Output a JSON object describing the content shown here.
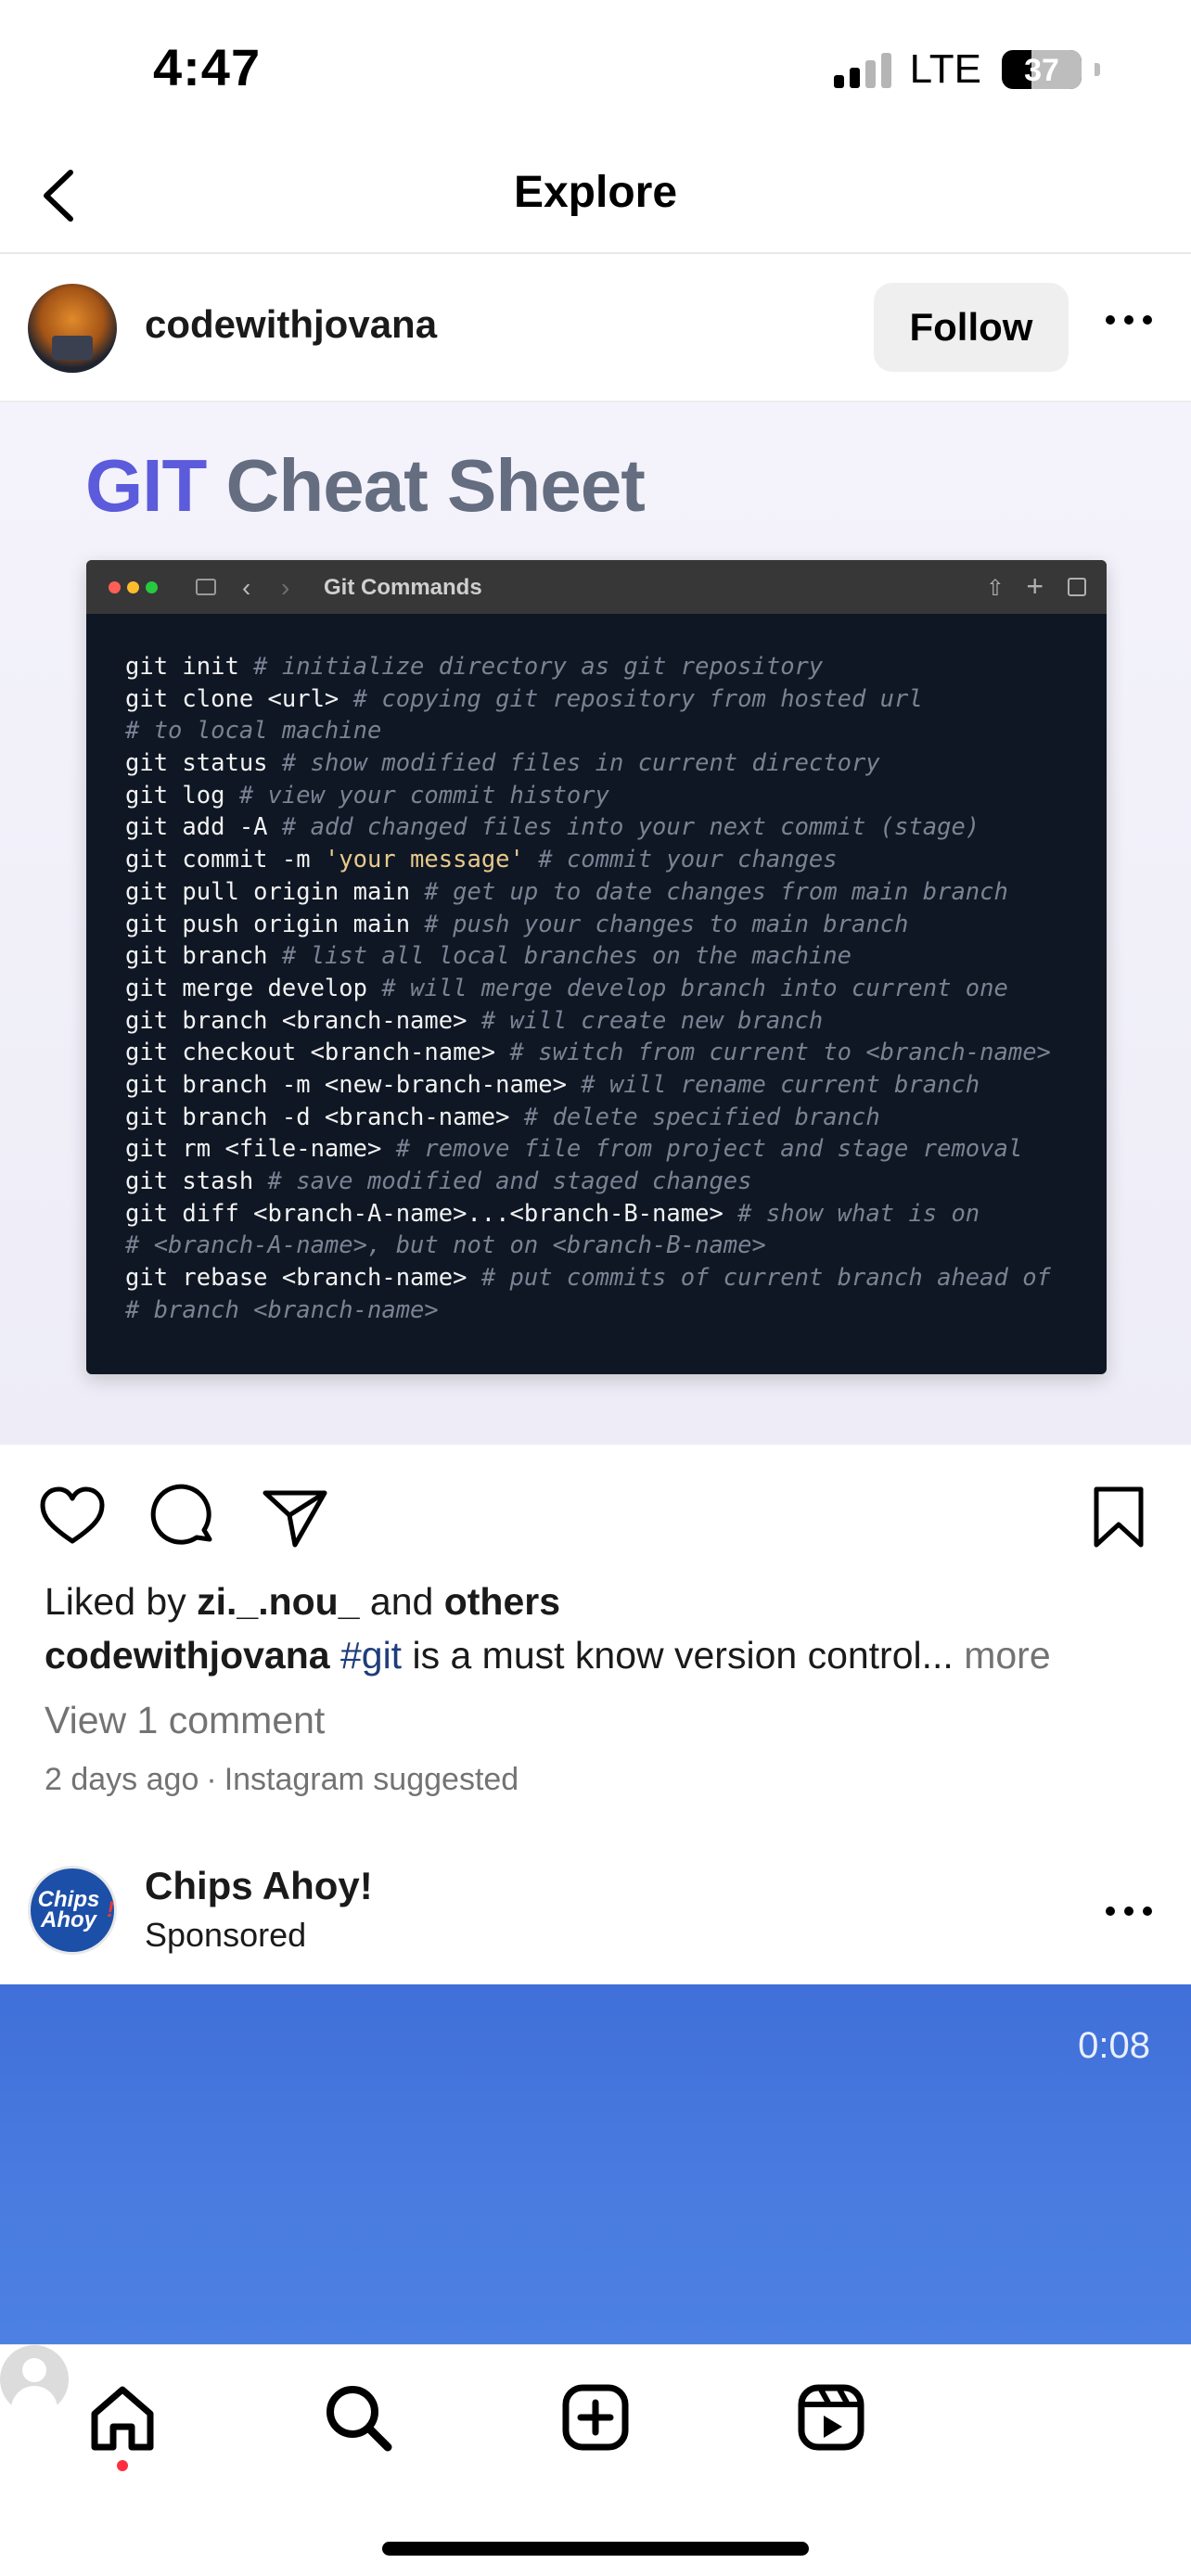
{
  "status_bar": {
    "time": "4:47",
    "network": "LTE",
    "battery": "37"
  },
  "nav": {
    "title": "Explore"
  },
  "post": {
    "username": "codewithjovana",
    "follow_label": "Follow",
    "image": {
      "title_accent": "GIT",
      "title_rest": " Cheat Sheet",
      "window_title": "Git Commands",
      "code_lines": [
        {
          "cmd": "git init ",
          "cmt": "# initialize directory as git repository"
        },
        {
          "cmd": "git clone <url> ",
          "cmt": "# copying git repository from hosted url"
        },
        {
          "cmd": "",
          "cmt": "# to local machine"
        },
        {
          "cmd": "git status ",
          "cmt": "# show modified files in current directory"
        },
        {
          "cmd": "git log ",
          "cmt": "# view your commit history"
        },
        {
          "cmd": "git add -A ",
          "cmt": "# add changed files into your next commit (stage)"
        },
        {
          "cmd": "git commit -m ",
          "str": "'your message'",
          "cmd2": " ",
          "cmt": "# commit your changes"
        },
        {
          "cmd": "git pull origin main ",
          "cmt": "# get up to date changes from main branch"
        },
        {
          "cmd": "git push origin main ",
          "cmt": "# push your changes to main branch"
        },
        {
          "cmd": "git branch ",
          "cmt": "# list all local branches on the machine"
        },
        {
          "cmd": "git merge develop ",
          "cmt": "# will merge develop branch into current one"
        },
        {
          "cmd": "git branch <branch-name> ",
          "cmt": "# will create new branch"
        },
        {
          "cmd": "git checkout <branch-name> ",
          "cmt": "# switch from current to <branch-name>"
        },
        {
          "cmd": "git branch -m <new-branch-name> ",
          "cmt": "# will rename current branch"
        },
        {
          "cmd": "git branch -d <branch-name> ",
          "cmt": "# delete specified branch"
        },
        {
          "cmd": "git rm <file-name> ",
          "cmt": "# remove file from project and stage removal"
        },
        {
          "cmd": "git stash ",
          "cmt": "# save modified and staged changes"
        },
        {
          "cmd": "git diff <branch-A-name>...<branch-B-name> ",
          "cmt": "# show what is on"
        },
        {
          "cmd": "",
          "cmt": "# <branch-A-name>, but not on <branch-B-name>"
        },
        {
          "cmd": "git rebase <branch-name> ",
          "cmt": "# put commits of current branch ahead of"
        },
        {
          "cmd": "",
          "cmt": "# branch <branch-name>"
        }
      ]
    },
    "likes_prefix": "Liked by ",
    "likes_user": "zi._.nou_",
    "likes_mid": " and ",
    "likes_others": "others",
    "caption_user": "codewithjovana",
    "caption_hashtag": "#git",
    "caption_text": " is a must know version control...",
    "caption_more": "more",
    "view_comments": "View 1 comment",
    "time_ago": "2 days ago",
    "separator": "·",
    "suggested": "Instagram suggested"
  },
  "sponsored": {
    "avatar_text": "Chips Ahoy",
    "avatar_excl": "!",
    "name": "Chips Ahoy!",
    "label": "Sponsored",
    "video_time": "0:08",
    "video_color": "#4a7ce0"
  },
  "tabbar": {
    "items": [
      "home-icon",
      "search-icon",
      "create-icon",
      "reels-icon",
      "profile-avatar"
    ],
    "notification_color": "#ff3040"
  },
  "colors": {
    "accent_git": "#5b5bdc",
    "hashtag": "#1e3d7b",
    "follow_bg": "#efefef"
  }
}
